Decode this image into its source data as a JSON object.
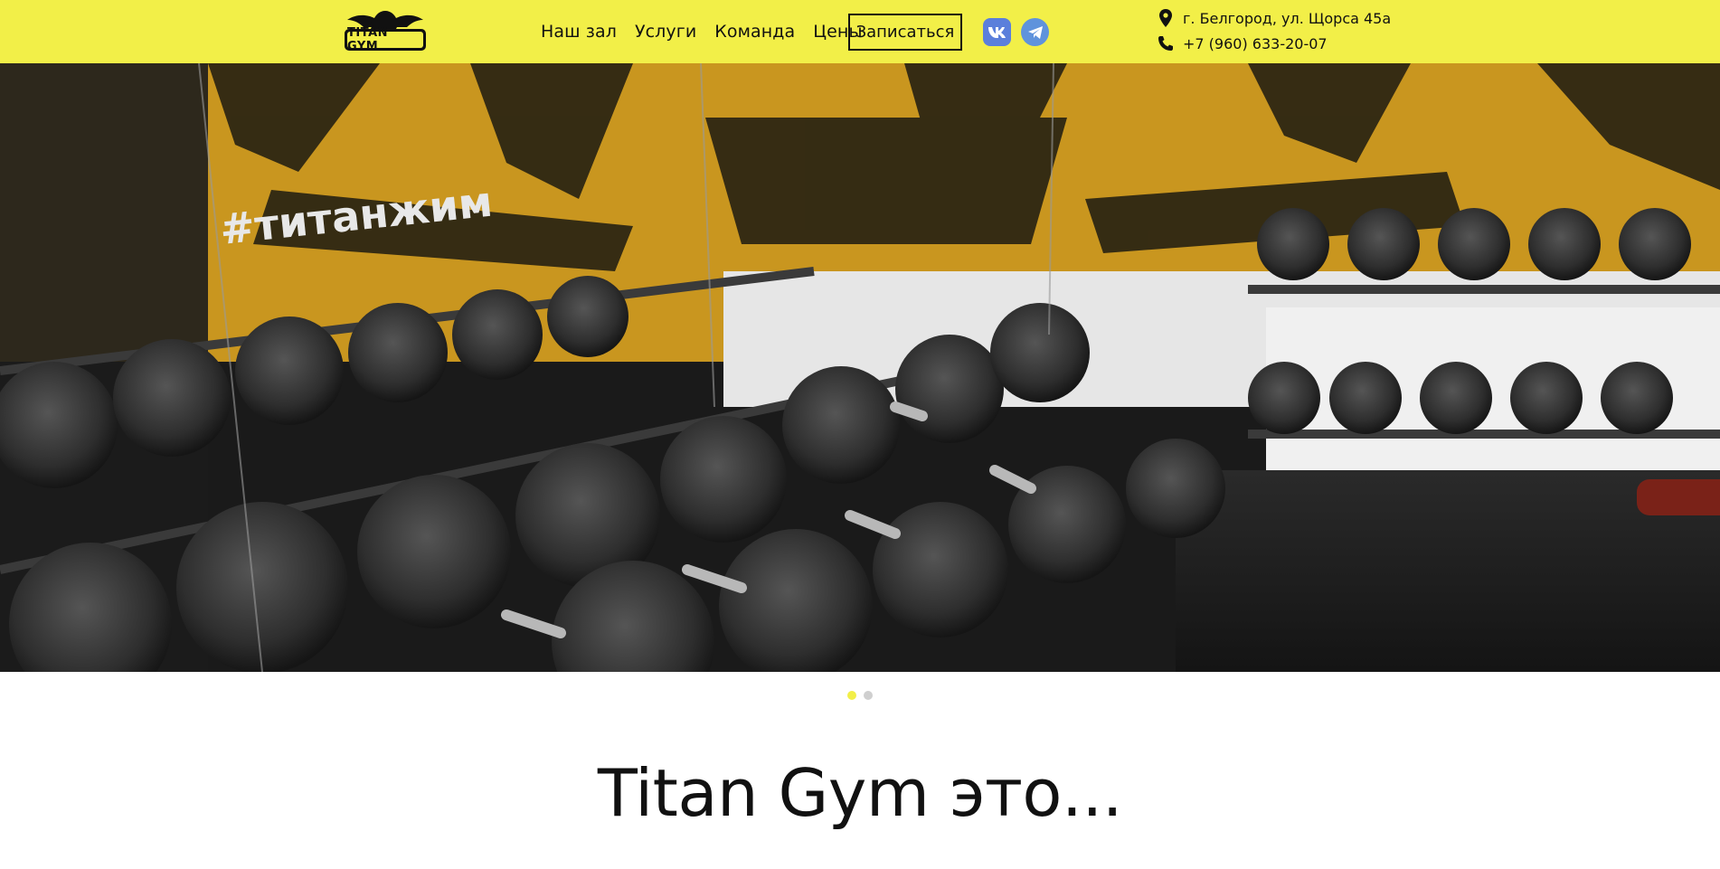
{
  "header": {
    "logo_text": "TITAN GYM",
    "nav": [
      "Наш зал",
      "Услуги",
      "Команда",
      "Цены"
    ],
    "signup_label": "Записаться",
    "social": [
      {
        "icon": "vk-icon",
        "label": "VK"
      },
      {
        "icon": "telegram-icon",
        "label": "Telegram"
      }
    ],
    "address": "г. Белгород, ул. Щорса 45а",
    "phone": "+7 (960) 633-20-07"
  },
  "hero": {
    "wall_hashtag": "#титанжим",
    "slides_count": 2,
    "active_slide": 1
  },
  "section": {
    "headline": "Titan Gym это..."
  },
  "colors": {
    "brand_yellow": "#f2ef48",
    "text": "#111111",
    "vk_blue": "#5b7fdb",
    "telegram_blue": "#5f93dc"
  }
}
